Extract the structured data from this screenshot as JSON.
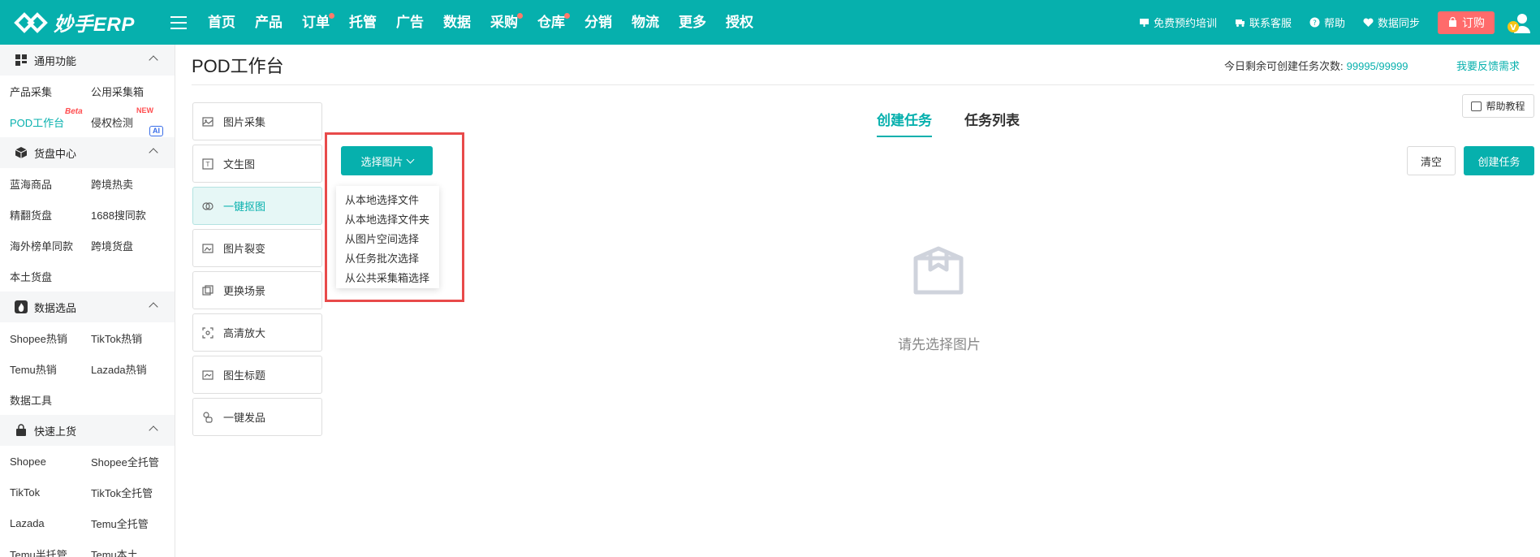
{
  "brand": {
    "name": "妙手ERP"
  },
  "nav": {
    "items": [
      {
        "label": "首页",
        "dot": false
      },
      {
        "label": "产品",
        "dot": false
      },
      {
        "label": "订单",
        "dot": true
      },
      {
        "label": "托管",
        "dot": false
      },
      {
        "label": "广告",
        "dot": false
      },
      {
        "label": "数据",
        "dot": false
      },
      {
        "label": "采购",
        "dot": true
      },
      {
        "label": "仓库",
        "dot": true
      },
      {
        "label": "分销",
        "dot": false
      },
      {
        "label": "物流",
        "dot": false
      },
      {
        "label": "更多",
        "dot": false
      },
      {
        "label": "授权",
        "dot": false
      }
    ],
    "right": {
      "training": "免费预约培训",
      "support": "联系客服",
      "help": "帮助",
      "sync": "数据同步",
      "order": "订购",
      "avatar_letter": "V"
    }
  },
  "sidebar": {
    "sections": [
      {
        "title": "通用功能",
        "rows": [
          [
            "产品采集",
            "公用采集箱"
          ],
          [
            "POD工作台",
            "侵权检测"
          ]
        ]
      },
      {
        "title": "货盘中心",
        "rows": [
          [
            "蓝海商品",
            "跨境热卖"
          ],
          [
            "精翻货盘",
            "1688搜同款"
          ],
          [
            "海外榜单同款",
            "跨境货盘"
          ],
          [
            "本土货盘",
            ""
          ]
        ]
      },
      {
        "title": "数据选品",
        "rows": [
          [
            "Shopee热销",
            "TikTok热销"
          ],
          [
            "Temu热销",
            "Lazada热销"
          ],
          [
            "数据工具",
            ""
          ]
        ]
      },
      {
        "title": "快速上货",
        "rows": [
          [
            "Shopee",
            "Shopee全托管"
          ],
          [
            "TikTok",
            "TikTok全托管"
          ],
          [
            "Lazada",
            "Temu全托管"
          ],
          [
            "Temu半托管",
            "Temu本土"
          ]
        ]
      }
    ],
    "badges": {
      "beta": "Beta",
      "new": "NEW",
      "ai": "AI"
    }
  },
  "header": {
    "title": "POD工作台",
    "quota_label": "今日剩余可创建任务次数:",
    "quota_value": "99995/99999",
    "feedback": "我要反馈需求"
  },
  "help_button": "帮助教程",
  "tools": [
    {
      "label": "图片采集",
      "icon": "image-icon"
    },
    {
      "label": "文生图",
      "icon": "text-to-image-icon"
    },
    {
      "label": "一键抠图",
      "icon": "cutout-icon"
    },
    {
      "label": "图片裂变",
      "icon": "image-variant-icon"
    },
    {
      "label": "更换场景",
      "icon": "scene-icon"
    },
    {
      "label": "高清放大",
      "icon": "upscale-icon"
    },
    {
      "label": "图生标题",
      "icon": "image-title-icon"
    },
    {
      "label": "一键发品",
      "icon": "publish-icon"
    }
  ],
  "active_tool": 2,
  "select": {
    "button": "选择图片",
    "options": [
      "从本地选择文件",
      "从本地选择文件夹",
      "从图片空间选择",
      "从任务批次选择",
      "从公共采集箱选择"
    ]
  },
  "tabs": [
    {
      "label": "创建任务",
      "active": true
    },
    {
      "label": "任务列表",
      "active": false
    }
  ],
  "actions": {
    "clear": "清空",
    "create": "创建任务"
  },
  "empty": {
    "text": "请先选择图片"
  },
  "colors": {
    "primary": "#06b0ad",
    "danger": "#ff6b6b",
    "highlight_frame": "#e84a4a"
  }
}
